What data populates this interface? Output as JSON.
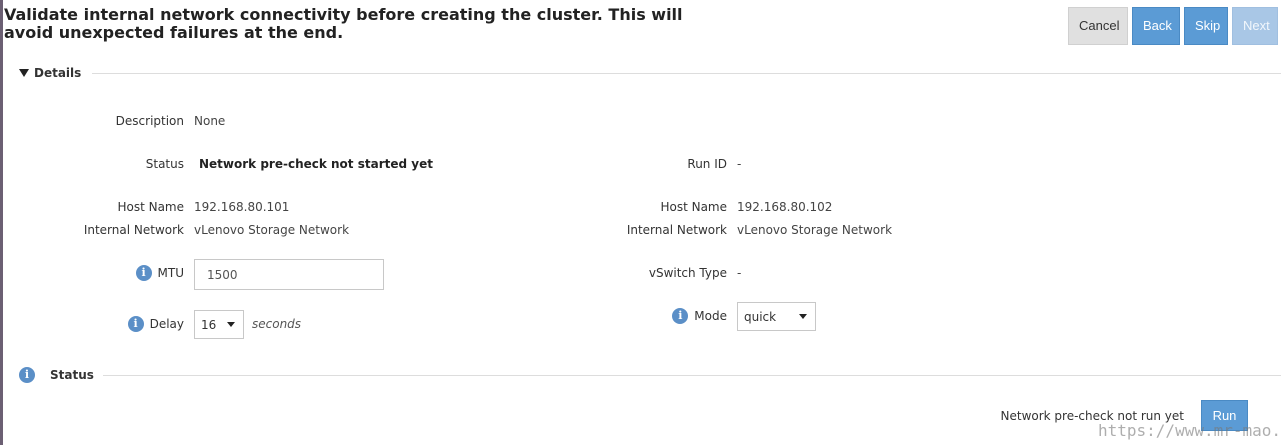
{
  "header": {
    "title": "Validate internal network connectivity before creating the cluster. This will avoid unexpected failures at the end.",
    "cancel_label": "Cancel",
    "back_label": "Back",
    "skip_label": "Skip",
    "next_label": "Next"
  },
  "details": {
    "section_title": "Details",
    "description_label": "Description",
    "description_value": "None",
    "status_label": "Status",
    "status_value": "Network pre-check not started yet",
    "run_id_label": "Run ID",
    "run_id_value": "-",
    "host1": {
      "host_name_label": "Host Name",
      "host_name_value": "192.168.80.101",
      "internal_network_label": "Internal Network",
      "internal_network_value": "vLenovo Storage Network"
    },
    "host2": {
      "host_name_label": "Host Name",
      "host_name_value": "192.168.80.102",
      "internal_network_label": "Internal Network",
      "internal_network_value": "vLenovo Storage Network"
    },
    "mtu_label": "MTU",
    "mtu_value": "1500",
    "vswitch_type_label": "vSwitch Type",
    "vswitch_type_value": "-",
    "delay_label": "Delay",
    "delay_value": "16",
    "delay_unit": "seconds",
    "mode_label": "Mode",
    "mode_value": "quick"
  },
  "status_section": {
    "section_title": "Status",
    "run_status": "Network pre-check not run yet",
    "run_label": "Run"
  },
  "watermark": "https://www.mr-mao.cn",
  "icons": {
    "info": "i"
  },
  "colors": {
    "accent": "#5b9bd5",
    "disabled": "#a9c7e6",
    "info_icon": "#5b8fc7"
  }
}
